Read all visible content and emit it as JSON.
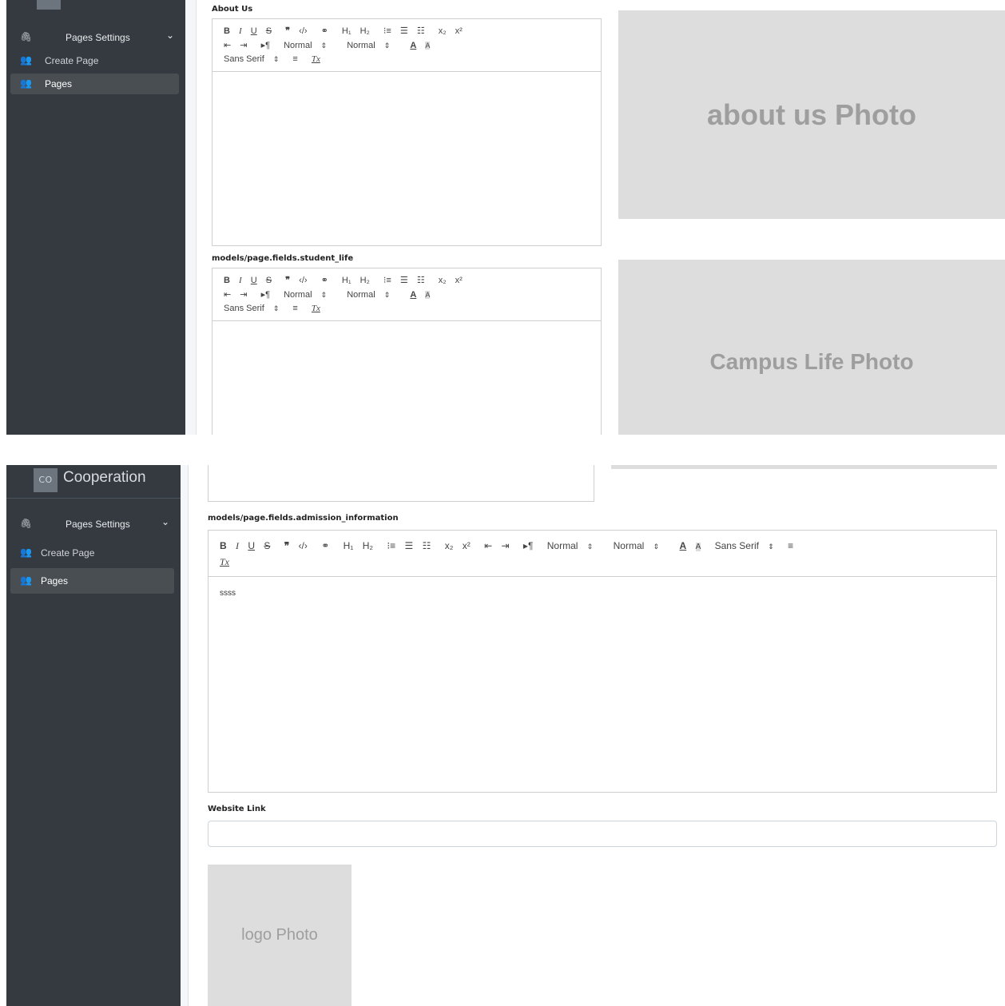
{
  "brand": {
    "logo_text": "CO",
    "name": "Cooperation"
  },
  "sidebar": {
    "section": {
      "label": "Pages Settings",
      "icon": "paperclip-icon",
      "toggle": "chevron-down-icon"
    },
    "items": [
      {
        "label": "Create Page",
        "icon": "users-icon"
      },
      {
        "label": "Pages",
        "icon": "users-icon",
        "active": true
      }
    ]
  },
  "toolbar": {
    "bold": "B",
    "italic": "I",
    "underline": "U",
    "strike": "S",
    "blockquote": "❞",
    "code": "‹/›",
    "link": "⚭",
    "h1": "H₁",
    "h2": "H₂",
    "ordered_list": "⁝≡",
    "bullet_list": "☰",
    "check_list": "☷",
    "subscript": "x₂",
    "superscript": "x²",
    "outdent": "⇤",
    "indent": "⇥",
    "direction": "▸¶",
    "size_value": "Normal",
    "header_value": "Normal",
    "color": "A",
    "background": "A",
    "font_value": "Sans Serif",
    "align": "≡",
    "clean": "Tx",
    "select_arrow": "⇕"
  },
  "fields": {
    "about_us": {
      "label": "About Us",
      "content": ""
    },
    "student_life": {
      "label": "models/page.fields.student_life",
      "content": ""
    },
    "admission_information": {
      "label": "models/page.fields.admission_information",
      "content": "ssss"
    },
    "website_link": {
      "label": "Website Link",
      "value": ""
    }
  },
  "photos": {
    "about_us": "about us Photo",
    "campus_life": "Campus Life Photo",
    "logo": "logo Photo"
  },
  "colors": {
    "sidebar_bg": "#343a40",
    "sidebar_active_bg": "#494e53",
    "placeholder_bg": "#dddddd",
    "placeholder_text": "#9e9e9e"
  }
}
